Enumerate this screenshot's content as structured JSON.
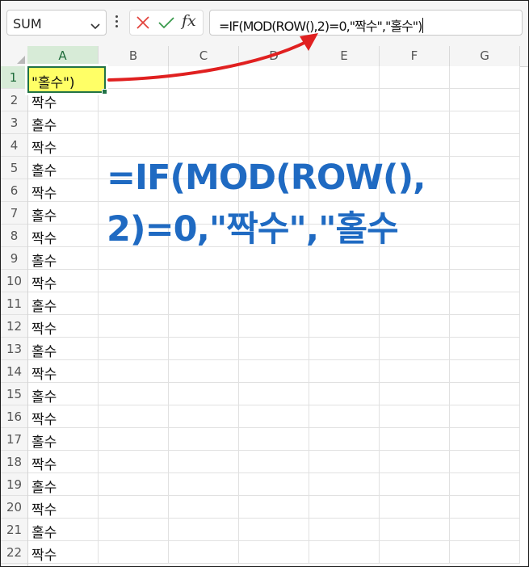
{
  "formula_bar": {
    "name_box": "SUM",
    "formula": "=IF(MOD(ROW(),2)=0,\"짝수\",\"홀수\")",
    "fx_label": "fx"
  },
  "columns": [
    "A",
    "B",
    "C",
    "D",
    "E",
    "F",
    "G"
  ],
  "rows": [
    {
      "num": "1",
      "a": "\"홀수\")"
    },
    {
      "num": "2",
      "a": "짝수"
    },
    {
      "num": "3",
      "a": "홀수"
    },
    {
      "num": "4",
      "a": "짝수"
    },
    {
      "num": "5",
      "a": "홀수"
    },
    {
      "num": "6",
      "a": "짝수"
    },
    {
      "num": "7",
      "a": "홀수"
    },
    {
      "num": "8",
      "a": "짝수"
    },
    {
      "num": "9",
      "a": "홀수"
    },
    {
      "num": "10",
      "a": "짝수"
    },
    {
      "num": "11",
      "a": "홀수"
    },
    {
      "num": "12",
      "a": "짝수"
    },
    {
      "num": "13",
      "a": "홀수"
    },
    {
      "num": "14",
      "a": "짝수"
    },
    {
      "num": "15",
      "a": "홀수"
    },
    {
      "num": "16",
      "a": "짝수"
    },
    {
      "num": "17",
      "a": "홀수"
    },
    {
      "num": "18",
      "a": "짝수"
    },
    {
      "num": "19",
      "a": "홀수"
    },
    {
      "num": "20",
      "a": "짝수"
    },
    {
      "num": "21",
      "a": "홀수"
    },
    {
      "num": "22",
      "a": "짝수"
    }
  ],
  "annotation": {
    "line1": "=IF(MOD(ROW(),",
    "line2": "2)=0,\"짝수\",\"홀수",
    "text_color": "#1f6ac2",
    "arrow_color": "#e02020",
    "highlight_color": "#ffff66"
  }
}
